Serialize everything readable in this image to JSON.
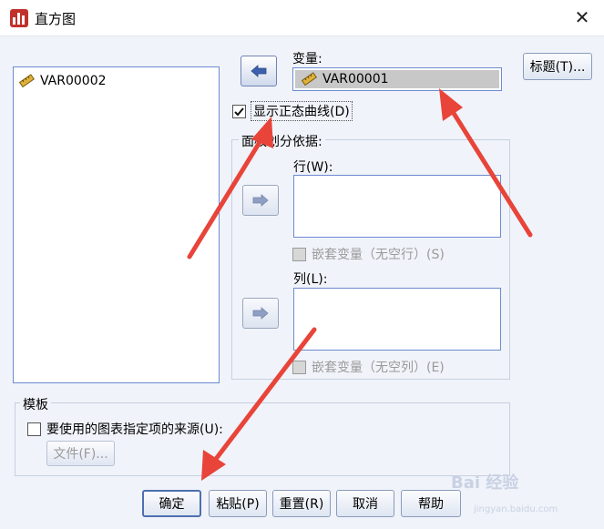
{
  "window": {
    "title": "直方图",
    "close_glyph": "✕"
  },
  "source_list": {
    "items": [
      {
        "label": "VAR00002",
        "icon": "ruler-icon"
      }
    ]
  },
  "variable": {
    "label": "变量:",
    "value": "VAR00001",
    "icon": "ruler-icon"
  },
  "normal_curve": {
    "label": "显示正态曲线(D)",
    "checked": true
  },
  "panel": {
    "label": "面板划分依据:",
    "rows_label": "行(W):",
    "nest_rows": "嵌套变量（无空行）(S)",
    "cols_label": "列(L):",
    "nest_cols": "嵌套变量（无空列）(E)"
  },
  "template": {
    "label": "模板",
    "checkbox_label": "要使用的图表指定项的来源(U):",
    "file_button": "文件(F)..."
  },
  "titles_button": "标题(T)...",
  "buttons": {
    "ok": "确定",
    "paste": "粘贴(P)",
    "reset": "重置(R)",
    "cancel": "取消",
    "help": "帮助"
  },
  "watermark": {
    "text": "Bai 经验",
    "sub": "jingyan.baidu.com"
  },
  "colors": {
    "accent": "#4e6fb0",
    "annotation_arrow": "#e8443a",
    "panel_bg": "#f0f3f9"
  }
}
